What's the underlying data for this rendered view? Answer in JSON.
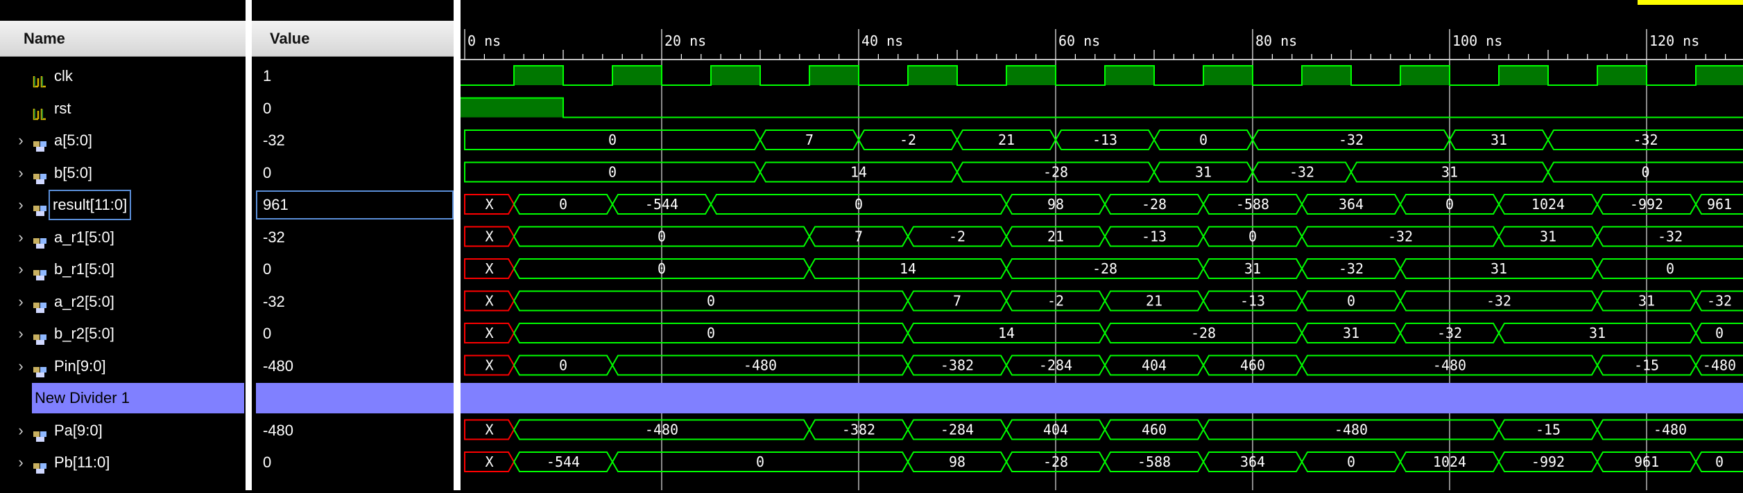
{
  "columns": {
    "name": "Name",
    "value": "Value"
  },
  "colors": {
    "wave": "#00ff00",
    "clock_fill": "#007700",
    "unknown": "#ff0000",
    "divider": "#8080ff",
    "cursor_marker": "#ffff00"
  },
  "signals": [
    {
      "name": "clk",
      "value": "1",
      "kind": "bit",
      "icon": "signal-bit-icon"
    },
    {
      "name": "rst",
      "value": "0",
      "kind": "bit",
      "icon": "signal-bit-icon"
    },
    {
      "name": "a[5:0]",
      "value": "-32",
      "kind": "bus",
      "icon": "signal-bus-icon"
    },
    {
      "name": "b[5:0]",
      "value": "0",
      "kind": "bus",
      "icon": "signal-bus-icon"
    },
    {
      "name": "result[11:0]",
      "value": "961",
      "kind": "bus",
      "icon": "signal-bus-icon",
      "selected": true
    },
    {
      "name": "a_r1[5:0]",
      "value": "-32",
      "kind": "bus",
      "icon": "signal-bus-icon"
    },
    {
      "name": "b_r1[5:0]",
      "value": "0",
      "kind": "bus",
      "icon": "signal-bus-icon"
    },
    {
      "name": "a_r2[5:0]",
      "value": "-32",
      "kind": "bus",
      "icon": "signal-bus-icon"
    },
    {
      "name": "b_r2[5:0]",
      "value": "0",
      "kind": "bus",
      "icon": "signal-bus-icon"
    },
    {
      "name": "Pin[9:0]",
      "value": "-480",
      "kind": "bus",
      "icon": "signal-bus-icon"
    },
    {
      "name": "New Divider 1",
      "value": "",
      "kind": "divider"
    },
    {
      "name": "Pa[9:0]",
      "value": "-480",
      "kind": "bus",
      "icon": "signal-bus-icon"
    },
    {
      "name": "Pb[11:0]",
      "value": "0",
      "kind": "bus",
      "icon": "signal-bus-icon"
    }
  ],
  "timeline": {
    "unit": "ns",
    "labels": [
      "0 ns",
      "20 ns",
      "40 ns",
      "60 ns",
      "80 ns",
      "100 ns",
      "120 ns"
    ],
    "major_step_ns": 20,
    "view_range_ns": [
      0,
      126.5
    ]
  },
  "waves": {
    "clk": {
      "period_ns": 10,
      "high_first_ns": 5
    },
    "rst": {
      "high_until_ns": 10
    },
    "a[5:0]": [
      {
        "t": 0,
        "v": "0"
      },
      {
        "t": 30,
        "v": "7"
      },
      {
        "t": 40,
        "v": "-2"
      },
      {
        "t": 50,
        "v": "21"
      },
      {
        "t": 60,
        "v": "-13"
      },
      {
        "t": 70,
        "v": "0"
      },
      {
        "t": 80,
        "v": "-32"
      },
      {
        "t": 100,
        "v": "31"
      },
      {
        "t": 110,
        "v": "-32"
      }
    ],
    "b[5:0]": [
      {
        "t": 0,
        "v": "0"
      },
      {
        "t": 30,
        "v": "14"
      },
      {
        "t": 50,
        "v": "-28"
      },
      {
        "t": 70,
        "v": "31"
      },
      {
        "t": 80,
        "v": "-32"
      },
      {
        "t": 90,
        "v": "31"
      },
      {
        "t": 110,
        "v": "0"
      }
    ],
    "result[11:0]": [
      {
        "t": 0,
        "v": "X",
        "x": true
      },
      {
        "t": 5,
        "v": "0"
      },
      {
        "t": 15,
        "v": "-544"
      },
      {
        "t": 25,
        "v": "0"
      },
      {
        "t": 55,
        "v": "98"
      },
      {
        "t": 65,
        "v": "-28"
      },
      {
        "t": 75,
        "v": "-588"
      },
      {
        "t": 85,
        "v": "364"
      },
      {
        "t": 95,
        "v": "0"
      },
      {
        "t": 105,
        "v": "1024"
      },
      {
        "t": 115,
        "v": "-992"
      },
      {
        "t": 125,
        "v": "961"
      }
    ],
    "a_r1[5:0]": [
      {
        "t": 0,
        "v": "X",
        "x": true
      },
      {
        "t": 5,
        "v": "0"
      },
      {
        "t": 35,
        "v": "7"
      },
      {
        "t": 45,
        "v": "-2"
      },
      {
        "t": 55,
        "v": "21"
      },
      {
        "t": 65,
        "v": "-13"
      },
      {
        "t": 75,
        "v": "0"
      },
      {
        "t": 85,
        "v": "-32"
      },
      {
        "t": 105,
        "v": "31"
      },
      {
        "t": 115,
        "v": "-32"
      }
    ],
    "b_r1[5:0]": [
      {
        "t": 0,
        "v": "X",
        "x": true
      },
      {
        "t": 5,
        "v": "0"
      },
      {
        "t": 35,
        "v": "14"
      },
      {
        "t": 55,
        "v": "-28"
      },
      {
        "t": 75,
        "v": "31"
      },
      {
        "t": 85,
        "v": "-32"
      },
      {
        "t": 95,
        "v": "31"
      },
      {
        "t": 115,
        "v": "0"
      }
    ],
    "a_r2[5:0]": [
      {
        "t": 0,
        "v": "X",
        "x": true
      },
      {
        "t": 5,
        "v": "0"
      },
      {
        "t": 45,
        "v": "7"
      },
      {
        "t": 55,
        "v": "-2"
      },
      {
        "t": 65,
        "v": "21"
      },
      {
        "t": 75,
        "v": "-13"
      },
      {
        "t": 85,
        "v": "0"
      },
      {
        "t": 95,
        "v": "-32"
      },
      {
        "t": 115,
        "v": "31"
      },
      {
        "t": 125,
        "v": "-32"
      }
    ],
    "b_r2[5:0]": [
      {
        "t": 0,
        "v": "X",
        "x": true
      },
      {
        "t": 5,
        "v": "0"
      },
      {
        "t": 45,
        "v": "14"
      },
      {
        "t": 65,
        "v": "-28"
      },
      {
        "t": 85,
        "v": "31"
      },
      {
        "t": 95,
        "v": "-32"
      },
      {
        "t": 105,
        "v": "31"
      },
      {
        "t": 125,
        "v": "0"
      }
    ],
    "Pin[9:0]": [
      {
        "t": 0,
        "v": "X",
        "x": true
      },
      {
        "t": 5,
        "v": "0"
      },
      {
        "t": 15,
        "v": "-480"
      },
      {
        "t": 45,
        "v": "-382"
      },
      {
        "t": 55,
        "v": "-284"
      },
      {
        "t": 65,
        "v": "404"
      },
      {
        "t": 75,
        "v": "460"
      },
      {
        "t": 85,
        "v": "-480"
      },
      {
        "t": 115,
        "v": "-15"
      },
      {
        "t": 125,
        "v": "-480"
      }
    ],
    "Pa[9:0]": [
      {
        "t": 0,
        "v": "X",
        "x": true
      },
      {
        "t": 5,
        "v": "-480"
      },
      {
        "t": 35,
        "v": "-382"
      },
      {
        "t": 45,
        "v": "-284"
      },
      {
        "t": 55,
        "v": "404"
      },
      {
        "t": 65,
        "v": "460"
      },
      {
        "t": 75,
        "v": "-480"
      },
      {
        "t": 105,
        "v": "-15"
      },
      {
        "t": 115,
        "v": "-480"
      }
    ],
    "Pb[11:0]": [
      {
        "t": 0,
        "v": "X",
        "x": true
      },
      {
        "t": 5,
        "v": "-544"
      },
      {
        "t": 15,
        "v": "0"
      },
      {
        "t": 45,
        "v": "98"
      },
      {
        "t": 55,
        "v": "-28"
      },
      {
        "t": 65,
        "v": "-588"
      },
      {
        "t": 75,
        "v": "364"
      },
      {
        "t": 85,
        "v": "0"
      },
      {
        "t": 95,
        "v": "1024"
      },
      {
        "t": 105,
        "v": "-992"
      },
      {
        "t": 115,
        "v": "961"
      },
      {
        "t": 125,
        "v": "0"
      }
    ]
  }
}
